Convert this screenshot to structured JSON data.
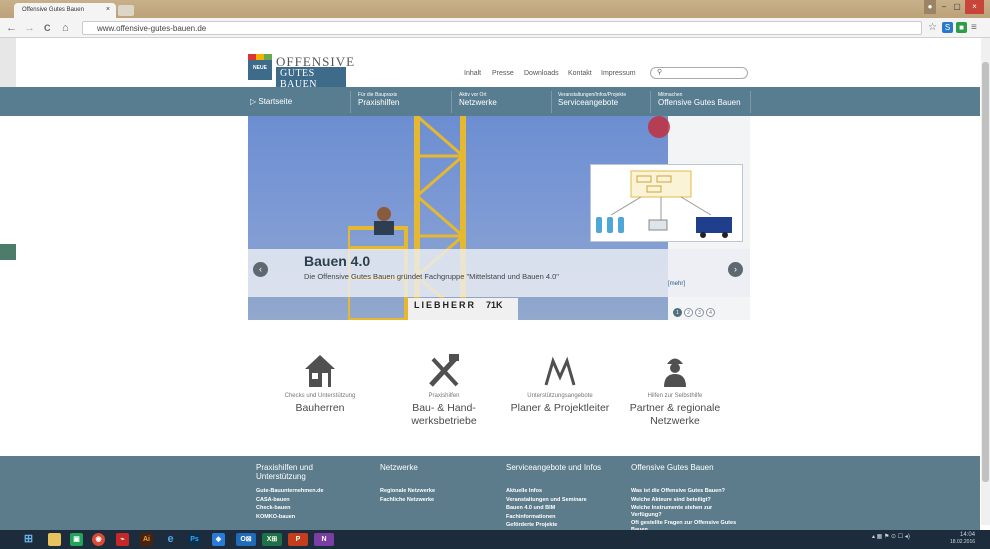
{
  "browser": {
    "tab_title": "Offensive Gutes Bauen",
    "tab_close": "×",
    "url": "www.offensive-gutes-bauen.de",
    "back": "←",
    "forward": "→",
    "reload": "C",
    "home": "⌂",
    "window_min": "–",
    "window_max": "▢",
    "window_close": "×"
  },
  "site": {
    "logo_line1": "OFFENSIVE",
    "logo_line2": "GUTES BAUEN",
    "logo_badge": "NEUE",
    "top_links": [
      "Inhalt",
      "Presse",
      "Downloads",
      "Kontakt",
      "Impressum"
    ],
    "search_icon": "magnifier-icon",
    "main_nav": [
      {
        "small": "",
        "big": "Startseite"
      },
      {
        "small": "Für die Baupraxis",
        "big": "Praxishilfen"
      },
      {
        "small": "Aktiv vor Ort",
        "big": "Netzwerke"
      },
      {
        "small": "Veranstaltungen/Infos/Projekte",
        "big": "Serviceangebote"
      },
      {
        "small": "Mitmachen",
        "big": "Offensive Gutes Bauen"
      }
    ]
  },
  "hero": {
    "title": "Bauen 4.0",
    "subtitle": "Die Offensive Gutes Bauen gründet Fachgruppe \"Mittelstand und Bauen 4.0\"",
    "more": "[mehr]",
    "crane_label": "LIEBHERR",
    "crane_load": "71K",
    "prev": "‹",
    "next": "›",
    "dots": [
      "1",
      "2",
      "3",
      "4"
    ],
    "active_dot": 0
  },
  "features": [
    {
      "sub": "Checks und Unterstützung",
      "title": "Bauherren",
      "icon": "house-icon"
    },
    {
      "sub": "Praxishilfen",
      "title": "Bau- & Hand-\nwerksbetriebe",
      "icon": "tools-icon"
    },
    {
      "sub": "Unterstützungsangebote",
      "title": "Planer & Projektleiter",
      "icon": "compass-icon"
    },
    {
      "sub": "Hilfen zur Selbsthilfe",
      "title": "Partner & regionale\nNetzwerke",
      "icon": "worker-icon"
    }
  ],
  "footer": [
    {
      "heading": "Praxishilfen und Unterstützung",
      "links": [
        "Gute-Bauunternehmen.de",
        "CASA-bauen",
        "Check-bauen",
        "KOMKO-bauen"
      ]
    },
    {
      "heading": "Netzwerke",
      "links": [
        "Regionale Netzwerke",
        "Fachliche Netzwerke"
      ]
    },
    {
      "heading": "Serviceangebote und Infos",
      "links": [
        "Aktuelle Infos",
        "Veranstaltungen und Seminare",
        "Bauen 4.0 und BIM",
        "Fachinformationen",
        "Geförderte Projekte"
      ]
    },
    {
      "heading": "Offensive Gutes Bauen",
      "links": [
        "Was ist die Offensive Gutes Bauen?",
        "Welche Akteure sind beteiligt?",
        "Welche Instrumente stehen zur Verfügung?",
        "Oft gestellte Fragen zur Offensive Gutes Bauen"
      ]
    }
  ],
  "taskbar": {
    "clock_time": "14:04",
    "clock_date": "18.02.2016",
    "apps": [
      "windows-start-icon",
      "file-explorer-icon",
      "store-icon",
      "chrome-icon",
      "acrobat-icon",
      "illustrator-icon",
      "ie-icon",
      "photoshop-icon",
      "dropbox-icon",
      "outlook-icon",
      "excel-icon",
      "powerpoint-icon",
      "onenote-icon"
    ]
  }
}
